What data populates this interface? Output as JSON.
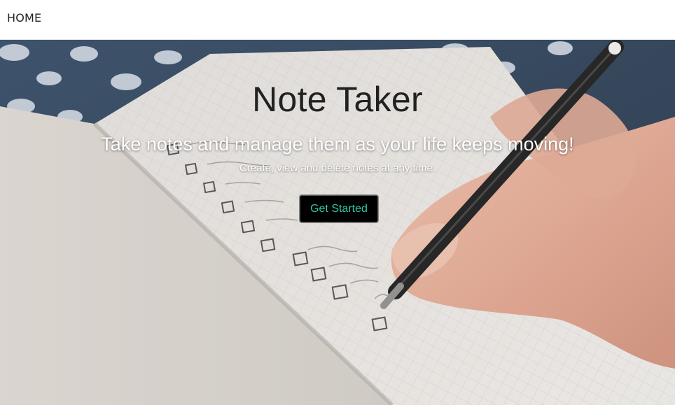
{
  "navbar": {
    "brand_label": "HOME"
  },
  "hero": {
    "title": "Note Taker",
    "subtitle": "Take notes and manage them as your life keeps moving!",
    "description": "Create, view and delete notes at any time.",
    "cta_label": "Get Started"
  },
  "colors": {
    "cta_background": "#000000",
    "cta_text": "#2ec7a6",
    "title_text": "#212121",
    "navbar_background": "#ffffff"
  }
}
